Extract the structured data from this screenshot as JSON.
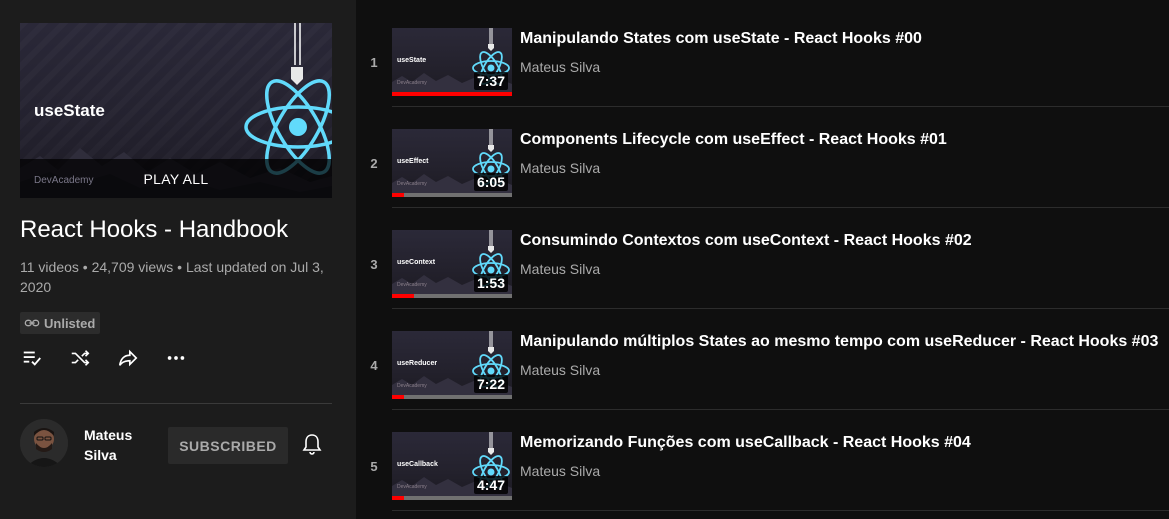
{
  "playlist": {
    "hero": {
      "thumbnail_text": "useState",
      "brand": "DevAcademy",
      "play_all_label": "PLAY ALL"
    },
    "title": "React Hooks - Handbook",
    "stats": "11 videos • 24,709 views • Last updated on Jul 3, 2020",
    "privacy_badge": "Unlisted",
    "privacy_icon": "link-icon",
    "actions": [
      {
        "name": "save-to-queue",
        "icon": "playlist-add-check-icon"
      },
      {
        "name": "shuffle",
        "icon": "shuffle-icon"
      },
      {
        "name": "share",
        "icon": "share-icon"
      },
      {
        "name": "more",
        "icon": "more-horiz-icon"
      }
    ]
  },
  "owner": {
    "name": "Mateus Silva",
    "subscribe_label": "SUBSCRIBED",
    "bell_icon": "bell-icon"
  },
  "videos": [
    {
      "index": "1",
      "title": "Manipulando States com useState - React Hooks #00",
      "channel": "Mateus Silva",
      "duration": "7:37",
      "thumb_label": "useState",
      "thumb_brand": "DevAcademy",
      "progress": 1.0
    },
    {
      "index": "2",
      "title": "Components Lifecycle com useEffect - React Hooks #01",
      "channel": "Mateus Silva",
      "duration": "6:05",
      "thumb_label": "useEffect",
      "thumb_brand": "DevAcademy",
      "progress": 0.1
    },
    {
      "index": "3",
      "title": "Consumindo Contextos com useContext - React Hooks #02",
      "channel": "Mateus Silva",
      "duration": "1:53",
      "thumb_label": "useContext",
      "thumb_brand": "DevAcademy",
      "progress": 0.18
    },
    {
      "index": "4",
      "title": "Manipulando múltiplos States ao mesmo tempo com useReducer - React Hooks #03",
      "channel": "Mateus Silva",
      "duration": "7:22",
      "thumb_label": "useReducer",
      "thumb_brand": "DevAcademy",
      "progress": 0.1
    },
    {
      "index": "5",
      "title": "Memorizando Funções com useCallback - React Hooks #04",
      "channel": "Mateus Silva",
      "duration": "4:47",
      "thumb_label": "useCallback",
      "thumb_brand": "DevAcademy",
      "progress": 0.1
    }
  ],
  "colors": {
    "background": "#0f0f0f",
    "sidebar": "#1c1c1c",
    "progress": "#ff0000",
    "react_blue": "#61dafb",
    "secondary_text": "#aaaaaa"
  }
}
